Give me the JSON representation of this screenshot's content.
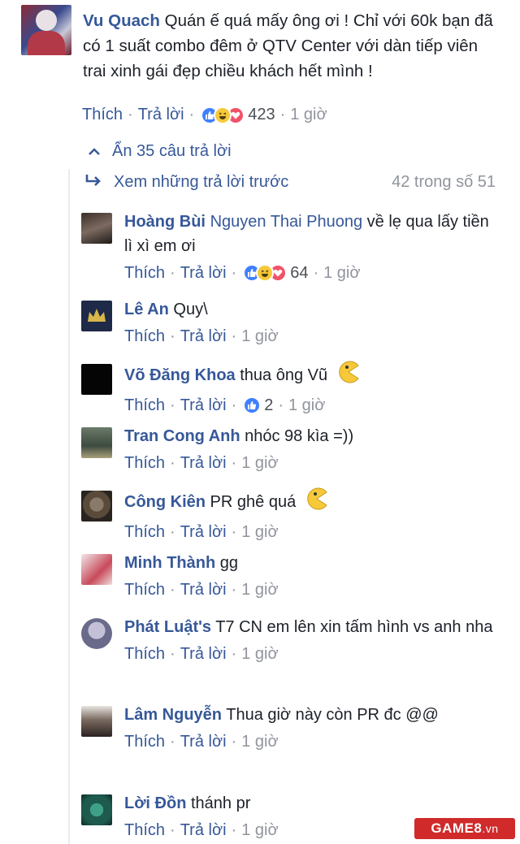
{
  "main_comment": {
    "author": "Vu Quach",
    "text": "Quán ế quá mấy ông ơi ! Chỉ với 60k bạn đã có 1 suất combo đêm ở QTV Center với dàn tiếp viên trai xinh gái đẹp chiều khách hết mình !",
    "like_label": "Thích",
    "reply_label": "Trả lời",
    "reaction_count": "423",
    "time": "1 giờ"
  },
  "hide_replies": "Ẩn 35 câu trả lời",
  "view_previous": {
    "label": "Xem những trả lời trước",
    "counter": "42 trong số 51"
  },
  "replies": [
    {
      "author": "Hoàng Bùi",
      "mention": "Nguyen Thai Phuong",
      "text": " về lẹ qua lấy tiền lì xì em ơi",
      "like_label": "Thích",
      "reply_label": "Trả lời",
      "reaction_count": "64",
      "time": "1 giờ"
    },
    {
      "author": "Lê An",
      "text": " Quy\\",
      "like_label": "Thích",
      "reply_label": "Trả lời",
      "time": "1 giờ"
    },
    {
      "author": "Võ Đăng Khoa",
      "text": " thua ông Vũ",
      "like_label": "Thích",
      "reply_label": "Trả lời",
      "reaction_count": "2",
      "time": "1 giờ"
    },
    {
      "author": "Tran Cong Anh",
      "text": " nhóc 98 kìa =))",
      "like_label": "Thích",
      "reply_label": "Trả lời",
      "time": "1 giờ"
    },
    {
      "author": "Công Kiên",
      "text": " PR ghê quá",
      "like_label": "Thích",
      "reply_label": "Trả lời",
      "time": "1 giờ"
    },
    {
      "author": "Minh Thành",
      "text": " gg",
      "like_label": "Thích",
      "reply_label": "Trả lời",
      "time": "1 giờ"
    },
    {
      "author": "Phát Luật's",
      "text": " T7 CN em lên xin tấm hình vs anh nha",
      "like_label": "Thích",
      "reply_label": "Trả lời",
      "time": "1 giờ"
    },
    {
      "author": "Lâm Nguyễn",
      "text": " Thua giờ này còn PR đc @@",
      "like_label": "Thích",
      "reply_label": "Trả lời",
      "time": "1 giờ"
    },
    {
      "author": "Lời Đồn",
      "text": " thánh pr",
      "like_label": "Thích",
      "reply_label": "Trả lời",
      "time": "1 giờ"
    }
  ],
  "watermark": {
    "brand": "GAME8",
    "tld": ".vn"
  },
  "colors": {
    "link": "#365899",
    "meta": "#90949c",
    "text": "#1d2129",
    "like": "#4080ff",
    "haha": "#f7c93a",
    "love": "#f25268"
  }
}
